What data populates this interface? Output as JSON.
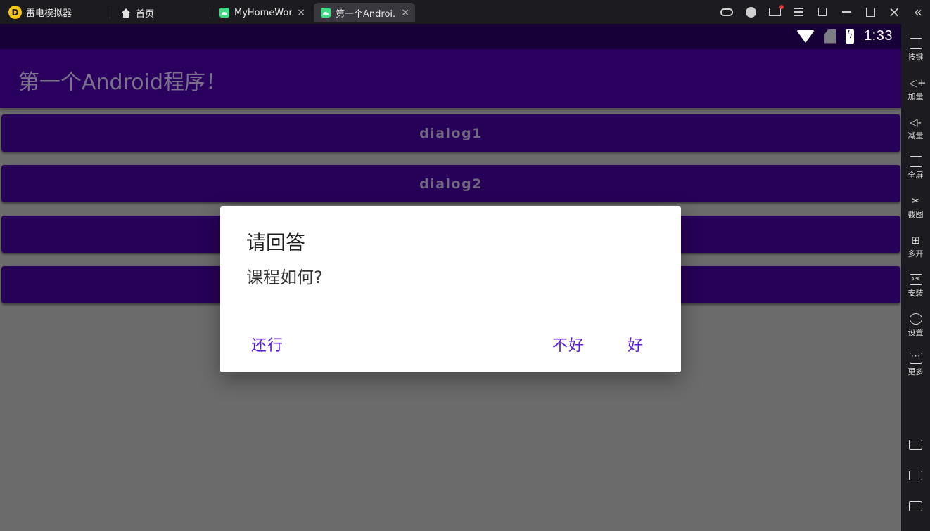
{
  "window": {
    "app_name": "雷电模拟器",
    "tabs": [
      {
        "label": "首页"
      },
      {
        "label": "MyHomeWor..."
      },
      {
        "label": "第一个Androi..."
      }
    ],
    "tab_close_glyph": "×"
  },
  "status_bar": {
    "time": "1:33"
  },
  "app": {
    "title": "第一个Android程序！",
    "buttons": [
      {
        "label": "dialog1"
      },
      {
        "label": "dialog2"
      },
      {
        "label": ""
      },
      {
        "label": ""
      }
    ]
  },
  "dialog": {
    "title": "请回答",
    "message": "课程如何?",
    "neutral_label": "还行",
    "negative_label": "不好",
    "positive_label": "好",
    "accent_color": "#5b1fd6"
  },
  "sidebar": {
    "items": [
      {
        "label": "按键",
        "icon": "keyboard-icon"
      },
      {
        "label": "加量",
        "icon": "volume-up-icon"
      },
      {
        "label": "减量",
        "icon": "volume-down-icon"
      },
      {
        "label": "全屏",
        "icon": "fullscreen-icon"
      },
      {
        "label": "截图",
        "icon": "scissors-icon"
      },
      {
        "label": "多开",
        "icon": "multi-instance-icon"
      },
      {
        "label": "安装",
        "icon": "apk-icon"
      },
      {
        "label": "设置",
        "icon": "gear-icon"
      },
      {
        "label": "更多",
        "icon": "more-icon"
      }
    ],
    "collapse_glyph": "«",
    "apk_text": "APK"
  },
  "colors": {
    "status_bar": "#170038",
    "app_bar": "#2a005f",
    "button": "#270058",
    "scrim": "#6b6b6b"
  }
}
